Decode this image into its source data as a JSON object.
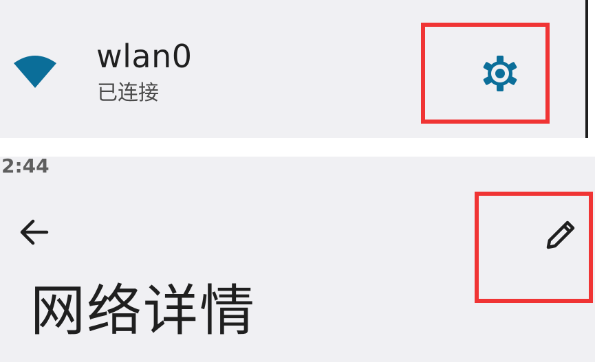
{
  "wifi_entry": {
    "name": "wlan0",
    "status": "已连接",
    "wifi_icon": "wifi-signal-full-icon",
    "settings_icon": "gear-icon",
    "accent_color": "#0b6e99"
  },
  "status_bar": {
    "time": "2:44"
  },
  "details_screen": {
    "back_icon": "arrow-back-icon",
    "edit_icon": "pencil-icon",
    "title": "网络详情"
  },
  "highlight_color": "#f03434"
}
